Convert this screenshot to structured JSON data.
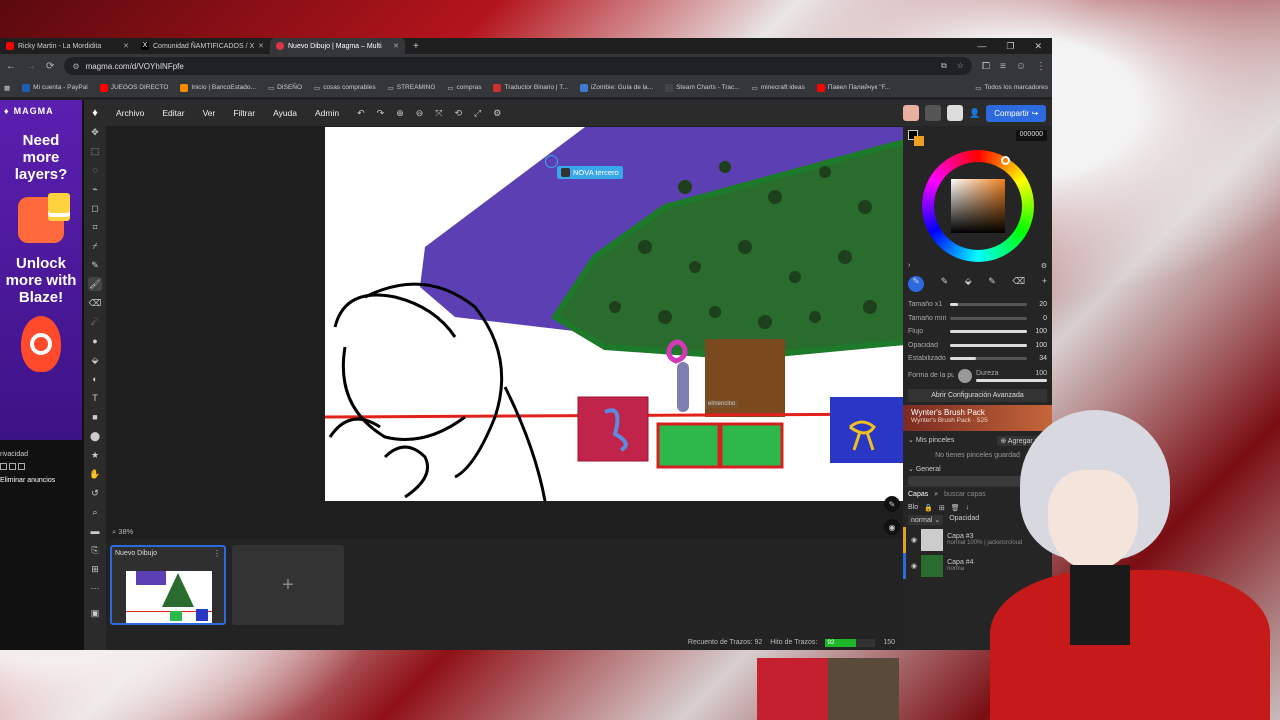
{
  "browser": {
    "tabs": [
      {
        "title": "Ricky Martin - La Mordidita",
        "color": "#ff0000"
      },
      {
        "title": "Comunidad ÑAMTIFICADOS / X",
        "color": "#ffffff"
      },
      {
        "title": "Nuevo Dibujo | Magma – Multi",
        "color": "#e0364d",
        "active": true
      }
    ],
    "new_tab": "+",
    "url": "magma.com/d/VOYhINFpfe",
    "bookmarks": [
      "Mi cuenta - PayPal",
      "JUEGOS DIRECTO",
      "Inicio | BancoEstado...",
      "DISEÑO",
      "cosas comprables",
      "STREAMING",
      "compras",
      "Traductor Binario | T...",
      "iZombie: Guía de la...",
      "Steam Charts - Trac...",
      "minecraft ideas",
      "Павел Палийчук \"F...",
      "Todos los marcadores"
    ]
  },
  "ad": {
    "logo": "MAGMA",
    "headline": "Need more layers?",
    "subline": "Unlock more with Blaze!",
    "privacy": "rivacidad",
    "remove_ads": "Eliminar anuncios"
  },
  "menu": {
    "items": [
      "Archivo",
      "Editar",
      "Ver",
      "Filtrar",
      "Ayuda",
      "Admin"
    ]
  },
  "canvas": {
    "cursor_user": "NOVA tercero",
    "other_user": "elmencino",
    "zoom": "38%"
  },
  "strip": {
    "drawing_name": "Nuevo Dibujo",
    "add_label": "+"
  },
  "status": {
    "strokes_label": "Recuento de Trazos: 92",
    "hit_label": "Hito de Trazos:",
    "hit_value": "92",
    "hit_max": "150",
    "hit_fraction": 0.61
  },
  "right_panel": {
    "share": "Compartir",
    "color_hex": "000000",
    "sliders": [
      {
        "label": "Tamaño x1",
        "value": "20",
        "fraction": 0.1
      },
      {
        "label": "Tamaño mínimo",
        "value": "0",
        "fraction": 0.0
      },
      {
        "label": "Flujo",
        "value": "100",
        "fraction": 1.0
      },
      {
        "label": "Opacidad",
        "value": "100",
        "fraction": 1.0
      },
      {
        "label": "Estabilizador",
        "value": "34",
        "fraction": 0.34
      }
    ],
    "shape_label": "Forma de la pu",
    "hardness_label": "Dureza",
    "hardness_value": "100",
    "advanced": "Abrir Configuración Avanzada",
    "brush_pack_title": "Wynter's Brush Pack",
    "brush_pack_sub": "Wynter's Brush Pack · 525",
    "my_brushes": "Mis pinceles",
    "add_brush": "Agregar pin",
    "no_brushes": "No tienes pinceles guardad",
    "general": "General",
    "layers_tab": "Capas",
    "layers_search": "buscar capas",
    "blend_label": "Blo",
    "blend_mode": "normal",
    "opacity_label": "Opacidad",
    "layers": [
      {
        "name": "Capa #3",
        "sub": "normal 100% | jacketsrcloud"
      },
      {
        "name": "Capa #4",
        "sub": "norma"
      }
    ]
  }
}
